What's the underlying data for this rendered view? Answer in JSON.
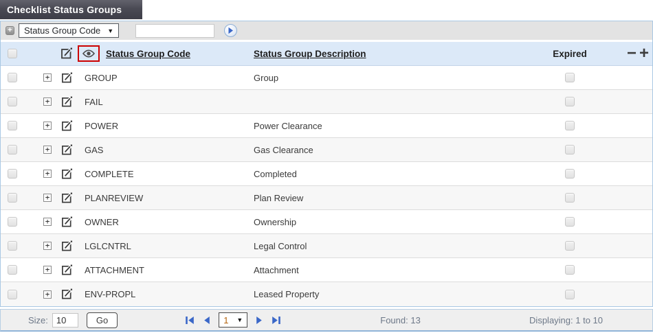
{
  "title": "Checklist Status Groups",
  "filter": {
    "field_selected": "Status Group Code",
    "search_value": ""
  },
  "icons": {
    "add_filter": "+",
    "dropdown_caret": "▼",
    "expand_row": "+",
    "collapse_columns": "−",
    "add_columns": "+",
    "page_caret": "▼"
  },
  "table": {
    "columns": [
      {
        "key": "code",
        "label": "Status Group Code",
        "sortable": true
      },
      {
        "key": "description",
        "label": "Status Group Description",
        "sortable": true
      },
      {
        "key": "expired",
        "label": "Expired",
        "sortable": false
      }
    ],
    "rows": [
      {
        "code": "GROUP",
        "description": "Group",
        "expired": false
      },
      {
        "code": "FAIL",
        "description": "",
        "expired": false
      },
      {
        "code": "POWER",
        "description": "Power Clearance",
        "expired": false
      },
      {
        "code": "GAS",
        "description": "Gas Clearance",
        "expired": false
      },
      {
        "code": "COMPLETE",
        "description": "Completed",
        "expired": false
      },
      {
        "code": "PLANREVIEW",
        "description": "Plan Review",
        "expired": false
      },
      {
        "code": "OWNER",
        "description": "Ownership",
        "expired": false
      },
      {
        "code": "LGLCNTRL",
        "description": "Legal Control",
        "expired": false
      },
      {
        "code": "ATTACHMENT",
        "description": "Attachment",
        "expired": false
      },
      {
        "code": "ENV-PROPL",
        "description": "Leased Property",
        "expired": false
      }
    ]
  },
  "footer": {
    "size_label": "Size:",
    "size_value": "10",
    "go_label": "Go",
    "page_value": "1",
    "found": "Found: 13",
    "displaying": "Displaying: 1 to 10"
  }
}
